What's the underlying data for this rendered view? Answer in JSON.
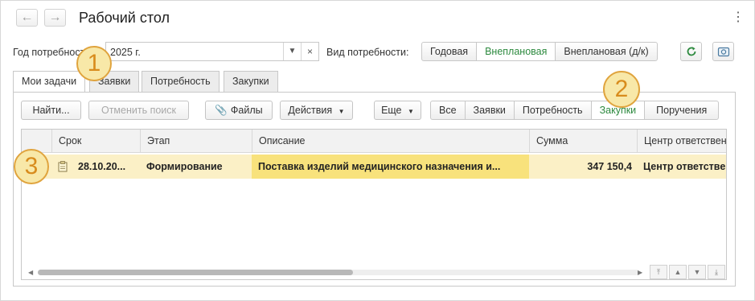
{
  "header": {
    "title": "Рабочий стол",
    "back_icon": "arrow-left-icon",
    "forward_icon": "arrow-right-icon",
    "menu_icon": "more-vertical-icon"
  },
  "filters": {
    "year_label": "Год потребности:",
    "year_value": "2025 г.",
    "need_type_label": "Вид потребности:",
    "need_types": [
      "Годовая",
      "Внеплановая",
      "Внеплановая (д/к)"
    ],
    "need_type_selected": "Внеплановая"
  },
  "tabs": [
    "Мои задачи",
    "Заявки",
    "Потребность",
    "Закупки"
  ],
  "tab_selected": "Мои задачи",
  "toolbar": {
    "find_label": "Найти...",
    "cancel_search_label": "Отменить поиск",
    "files_label": "Файлы",
    "actions_label": "Действия",
    "more_label": "Еще",
    "filter_segments": [
      "Все",
      "Заявки",
      "Потребность",
      "Закупки",
      "Поручения"
    ],
    "filter_selected": "Закупки"
  },
  "table": {
    "columns": [
      "Срок",
      "Этап",
      "Описание",
      "Сумма",
      "Центр ответственности"
    ],
    "rows": [
      {
        "date": "28.10.20...",
        "stage": "Формирование",
        "description": "Поставка изделий медицинского назначения и...",
        "amount": "347 150,4",
        "center": "Центр ответственности"
      }
    ]
  },
  "annotations": [
    "1",
    "2",
    "3"
  ],
  "colors": {
    "accent_green": "#2d8a3f",
    "row_highlight": "#fbf0c6",
    "cell_selected": "#f8e27c",
    "annotation_orange": "#e0a43e"
  }
}
